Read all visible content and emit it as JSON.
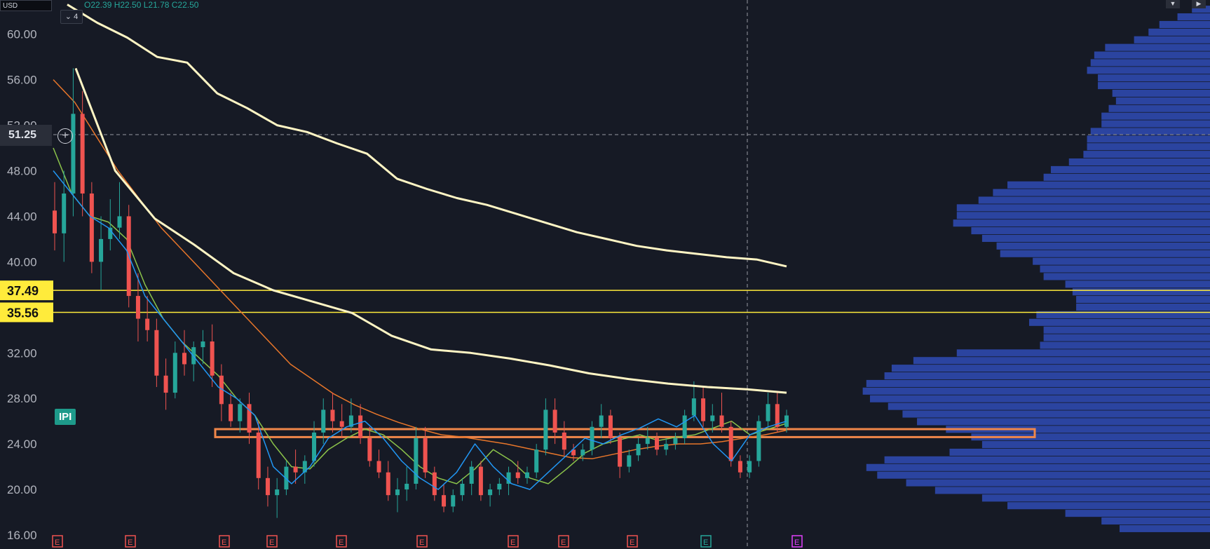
{
  "header": {
    "symbol_box": "USD",
    "interval": "4",
    "ohlc_text": "O22.39  H22.50  L21.78  C22.50"
  },
  "ticker_label": "IPI",
  "crosshair_price": "51.25",
  "colors": {
    "background": "#161a25",
    "axis_text": "#b2b5be",
    "candle_up": "#26a69a",
    "candle_down": "#ef5350",
    "ema_fast": "#2196f3",
    "ema_mid": "#8bc34a",
    "ema_slow": "#e8762a",
    "vwap": "#fff5c4",
    "level_line": "#ffeb3b",
    "zone": "#f0874a",
    "volume_profile": "#2b44a0"
  },
  "chart_data": {
    "type": "line",
    "ylim": [
      16,
      63
    ],
    "y_ticks": [
      "60.00",
      "56.00",
      "52.00",
      "48.00",
      "44.00",
      "40.00",
      "36.00",
      "32.00",
      "28.00",
      "24.00",
      "20.00",
      "16.00"
    ],
    "price_levels": [
      {
        "label": "37.49",
        "value": 37.49
      },
      {
        "label": "35.56",
        "value": 35.56
      }
    ],
    "zone": {
      "low": 24.6,
      "high": 25.3
    },
    "series": [
      {
        "key": "vwap_upper",
        "values": [
          62.6,
          61,
          59.7,
          58,
          57.5,
          54.8,
          53.5,
          52,
          51.4,
          50.4,
          49.5,
          47.3,
          46.4,
          45.6,
          45.0,
          44.2,
          43.4,
          42.6,
          42.0,
          41.4,
          41.0,
          40.7,
          40.4,
          40.2,
          39.6
        ]
      },
      {
        "key": "vwap_lower",
        "values": [
          57,
          48,
          43.8,
          41.5,
          39,
          37.5,
          36.5,
          35.5,
          33.5,
          32.3,
          32.0,
          31.5,
          30.9,
          30.2,
          29.7,
          29.3,
          29.0,
          28.8,
          28.5
        ]
      },
      {
        "key": "ema_slow",
        "values": [
          56,
          54,
          51,
          48,
          45.5,
          43,
          41,
          39,
          37,
          35,
          33,
          31,
          29.7,
          28.4,
          27.4,
          26.6,
          25.9,
          25.3,
          24.8,
          24.6,
          24.3,
          24,
          23.6,
          23.2,
          22.8,
          22.7,
          23.1,
          23.5,
          23.8,
          24.0,
          24.0,
          24.2,
          24.5,
          24.8,
          25.2
        ]
      },
      {
        "key": "ema_mid",
        "values": [
          50,
          46,
          44,
          43.5,
          42,
          38,
          35,
          33,
          31.5,
          30,
          28,
          26.5,
          24,
          22,
          21.8,
          23.5,
          24.5,
          25.3,
          24.8,
          23.5,
          22.0,
          21.0,
          20.5,
          21.8,
          23.5,
          22.5,
          21.0,
          20.5,
          21.8,
          23.2,
          24.0,
          24.4,
          24.8,
          24.3,
          24.6,
          24.8,
          25.4,
          26.0,
          24.8,
          25.3,
          25.8
        ]
      },
      {
        "key": "ema_fast",
        "values": [
          48,
          46,
          44,
          43,
          41,
          37,
          35,
          33,
          31,
          29,
          28,
          26.5,
          22,
          20.5,
          22.0,
          24.5,
          25.5,
          26.0,
          24.5,
          22.5,
          21.0,
          20.0,
          21.5,
          24.0,
          22.0,
          20.5,
          20.0,
          21.5,
          23.0,
          24.5,
          24.0,
          24.8,
          25.4,
          26.2,
          25.5,
          26.5,
          24.0,
          22.5,
          24.8,
          25.5,
          26.0
        ]
      }
    ],
    "candles": [
      {
        "o": 44.5,
        "h": 47,
        "l": 41,
        "c": 42.5
      },
      {
        "o": 42.5,
        "h": 48,
        "l": 40,
        "c": 46
      },
      {
        "o": 46,
        "h": 57,
        "l": 44,
        "c": 53
      },
      {
        "o": 53,
        "h": 55,
        "l": 44,
        "c": 46
      },
      {
        "o": 46,
        "h": 47,
        "l": 39,
        "c": 40
      },
      {
        "o": 40,
        "h": 44,
        "l": 37.5,
        "c": 42
      },
      {
        "o": 42,
        "h": 45.5,
        "l": 41,
        "c": 43
      },
      {
        "o": 43,
        "h": 47,
        "l": 42,
        "c": 44
      },
      {
        "o": 44,
        "h": 45,
        "l": 36,
        "c": 37
      },
      {
        "o": 37,
        "h": 39,
        "l": 33,
        "c": 35
      },
      {
        "o": 35,
        "h": 37,
        "l": 33,
        "c": 34
      },
      {
        "o": 34,
        "h": 35,
        "l": 29,
        "c": 30
      },
      {
        "o": 30,
        "h": 31.5,
        "l": 27,
        "c": 28.5
      },
      {
        "o": 28.5,
        "h": 33,
        "l": 28,
        "c": 32
      },
      {
        "o": 32,
        "h": 34,
        "l": 30,
        "c": 31
      },
      {
        "o": 31,
        "h": 33,
        "l": 29.5,
        "c": 32.5
      },
      {
        "o": 32.5,
        "h": 34,
        "l": 31,
        "c": 33
      },
      {
        "o": 33,
        "h": 34.5,
        "l": 29,
        "c": 30
      },
      {
        "o": 30,
        "h": 31,
        "l": 26,
        "c": 27.5
      },
      {
        "o": 27.5,
        "h": 28.5,
        "l": 25.5,
        "c": 26
      },
      {
        "o": 26,
        "h": 28,
        "l": 25,
        "c": 27.5
      },
      {
        "o": 27.5,
        "h": 28.5,
        "l": 24,
        "c": 25
      },
      {
        "o": 25,
        "h": 26,
        "l": 20,
        "c": 21
      },
      {
        "o": 21,
        "h": 22,
        "l": 18.5,
        "c": 19.5
      },
      {
        "o": 19.5,
        "h": 21,
        "l": 17.5,
        "c": 20
      },
      {
        "o": 20,
        "h": 22.5,
        "l": 19.5,
        "c": 22
      },
      {
        "o": 22,
        "h": 23.5,
        "l": 20.5,
        "c": 21.5
      },
      {
        "o": 21.5,
        "h": 23,
        "l": 20.5,
        "c": 22.5
      },
      {
        "o": 22.5,
        "h": 26,
        "l": 22,
        "c": 25
      },
      {
        "o": 25,
        "h": 28,
        "l": 24,
        "c": 27
      },
      {
        "o": 27,
        "h": 28.5,
        "l": 25,
        "c": 26
      },
      {
        "o": 26,
        "h": 27.5,
        "l": 24.5,
        "c": 25.5
      },
      {
        "o": 25.5,
        "h": 28,
        "l": 25,
        "c": 26.5
      },
      {
        "o": 26.5,
        "h": 27.5,
        "l": 24,
        "c": 24.5
      },
      {
        "o": 24.5,
        "h": 25.5,
        "l": 22,
        "c": 22.5
      },
      {
        "o": 22.5,
        "h": 23.5,
        "l": 21,
        "c": 21.5
      },
      {
        "o": 21.5,
        "h": 22.5,
        "l": 19,
        "c": 19.5
      },
      {
        "o": 19.5,
        "h": 21,
        "l": 18,
        "c": 20
      },
      {
        "o": 20,
        "h": 22,
        "l": 19,
        "c": 20.5
      },
      {
        "o": 20.5,
        "h": 25.5,
        "l": 20,
        "c": 24.5
      },
      {
        "o": 24.5,
        "h": 25.5,
        "l": 21,
        "c": 21.5
      },
      {
        "o": 21.5,
        "h": 22,
        "l": 19,
        "c": 19.5
      },
      {
        "o": 19.5,
        "h": 20.5,
        "l": 18,
        "c": 18.5
      },
      {
        "o": 18.5,
        "h": 20,
        "l": 18,
        "c": 19.5
      },
      {
        "o": 19.5,
        "h": 21,
        "l": 19,
        "c": 20.5
      },
      {
        "o": 20.5,
        "h": 22.5,
        "l": 19.5,
        "c": 22
      },
      {
        "o": 22,
        "h": 22.5,
        "l": 19,
        "c": 19.5
      },
      {
        "o": 19.5,
        "h": 20.5,
        "l": 18.5,
        "c": 20
      },
      {
        "o": 20,
        "h": 21,
        "l": 19.5,
        "c": 20.5
      },
      {
        "o": 20.5,
        "h": 22,
        "l": 19.5,
        "c": 21.5
      },
      {
        "o": 21.5,
        "h": 22.5,
        "l": 20.5,
        "c": 21
      },
      {
        "o": 21,
        "h": 22,
        "l": 20.5,
        "c": 21.5
      },
      {
        "o": 21.5,
        "h": 24,
        "l": 21,
        "c": 23.5
      },
      {
        "o": 23.5,
        "h": 28,
        "l": 23,
        "c": 27
      },
      {
        "o": 27,
        "h": 28,
        "l": 24,
        "c": 25
      },
      {
        "o": 25,
        "h": 26,
        "l": 23,
        "c": 23.5
      },
      {
        "o": 23.5,
        "h": 24,
        "l": 22.5,
        "c": 23
      },
      {
        "o": 23,
        "h": 24,
        "l": 22.5,
        "c": 23.5
      },
      {
        "o": 23.5,
        "h": 26,
        "l": 23,
        "c": 25.5
      },
      {
        "o": 25.5,
        "h": 27.5,
        "l": 24.5,
        "c": 26.5
      },
      {
        "o": 26.5,
        "h": 27,
        "l": 24,
        "c": 24.5
      },
      {
        "o": 24.5,
        "h": 25,
        "l": 21,
        "c": 22
      },
      {
        "o": 22,
        "h": 23.5,
        "l": 21.5,
        "c": 23
      },
      {
        "o": 23,
        "h": 24.5,
        "l": 22.5,
        "c": 24
      },
      {
        "o": 24,
        "h": 25.5,
        "l": 23.5,
        "c": 24.5
      },
      {
        "o": 24.5,
        "h": 25,
        "l": 23,
        "c": 23.5
      },
      {
        "o": 23.5,
        "h": 24.5,
        "l": 23,
        "c": 24
      },
      {
        "o": 24,
        "h": 25,
        "l": 23.5,
        "c": 24.5
      },
      {
        "o": 24.5,
        "h": 27,
        "l": 24,
        "c": 26.5
      },
      {
        "o": 26.5,
        "h": 29.5,
        "l": 26,
        "c": 28
      },
      {
        "o": 28,
        "h": 29,
        "l": 25.5,
        "c": 26
      },
      {
        "o": 26,
        "h": 27.5,
        "l": 25,
        "c": 26.5
      },
      {
        "o": 26.5,
        "h": 28.5,
        "l": 25,
        "c": 25.5
      },
      {
        "o": 25.5,
        "h": 26,
        "l": 22,
        "c": 22.5
      },
      {
        "o": 22.5,
        "h": 23,
        "l": 21,
        "c": 21.5
      },
      {
        "o": 21.5,
        "h": 23,
        "l": 21,
        "c": 22.5
      },
      {
        "o": 22.5,
        "h": 26.5,
        "l": 22,
        "c": 26
      },
      {
        "o": 26,
        "h": 28.5,
        "l": 25.5,
        "c": 27.5
      },
      {
        "o": 27.5,
        "h": 28.5,
        "l": 25,
        "c": 25.5
      },
      {
        "o": 25.5,
        "h": 27,
        "l": 25,
        "c": 26.5
      }
    ],
    "volume_profile": [
      0.05,
      0.09,
      0.14,
      0.17,
      0.21,
      0.29,
      0.32,
      0.33,
      0.34,
      0.31,
      0.31,
      0.27,
      0.26,
      0.28,
      0.3,
      0.3,
      0.33,
      0.34,
      0.34,
      0.35,
      0.39,
      0.44,
      0.46,
      0.56,
      0.6,
      0.64,
      0.7,
      0.7,
      0.71,
      0.66,
      0.63,
      0.59,
      0.58,
      0.49,
      0.47,
      0.46,
      0.4,
      0.38,
      0.37,
      0.37,
      0.48,
      0.5,
      0.46,
      0.46,
      0.47,
      0.7,
      0.82,
      0.88,
      0.9,
      0.95,
      0.96,
      0.94,
      0.89,
      0.85,
      0.81,
      0.73,
      0.66,
      0.63,
      0.72,
      0.9,
      0.95,
      0.92,
      0.84,
      0.76,
      0.63,
      0.56,
      0.4,
      0.3,
      0.25
    ],
    "earnings_markers": [
      "E",
      "E",
      "E",
      "E",
      "E",
      "E",
      "E",
      "E",
      "E",
      "E",
      "E"
    ]
  }
}
